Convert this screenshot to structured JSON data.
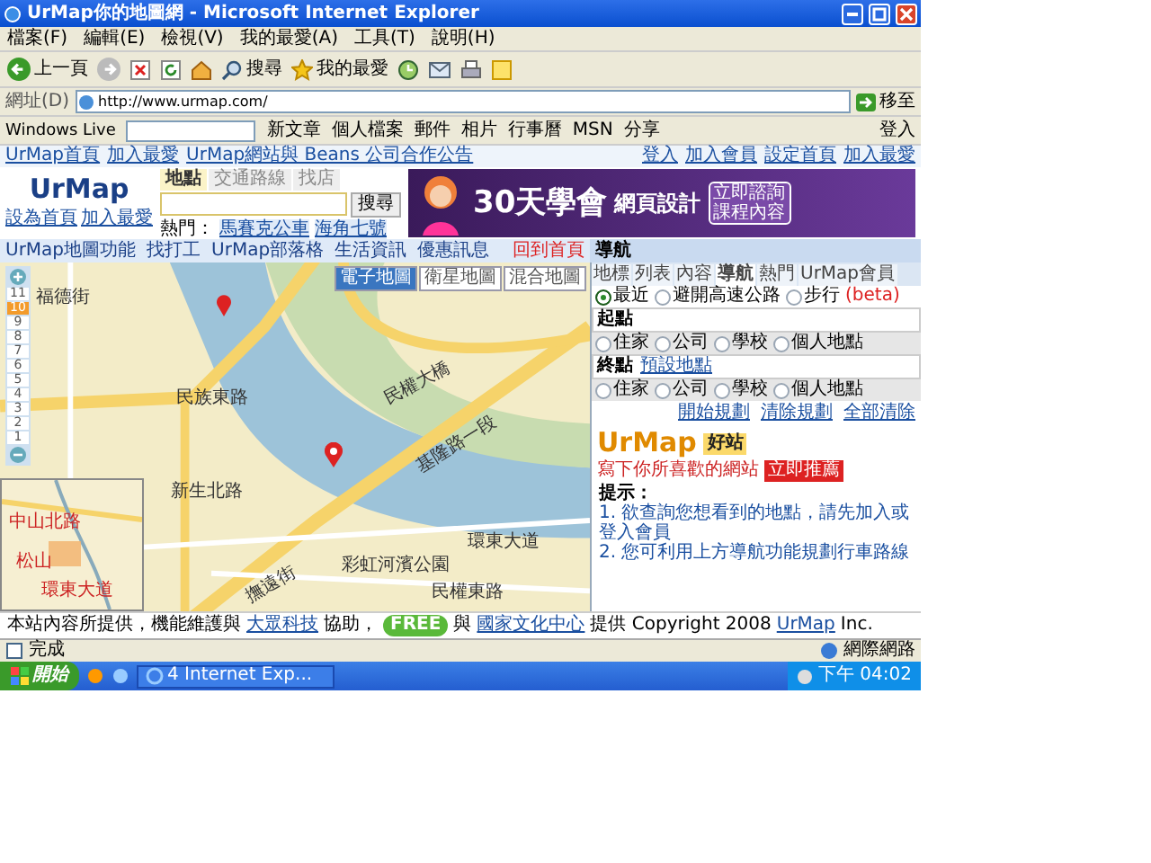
{
  "window": {
    "title": "UrMap你的地圖網 - Microsoft Internet Explorer"
  },
  "menu": [
    "檔案(F)",
    "編輯(E)",
    "檢視(V)",
    "我的最愛(A)",
    "工具(T)",
    "說明(H)"
  ],
  "toolbar": {
    "back": "上一頁",
    "search": "搜尋",
    "favorites": "我的最愛"
  },
  "address_bar": {
    "label": "網址(D)",
    "value": "http://www.urmap.com/",
    "go": "移至"
  },
  "live_bar": {
    "brand": "Windows Live",
    "items": [
      "新文章",
      "個人檔案",
      "郵件",
      "相片",
      "行事曆",
      "MSN",
      "分享"
    ],
    "signin": "登入"
  },
  "site_links": {
    "left": [
      "UrMap首頁",
      "加入最愛"
    ],
    "notice": "UrMap網站與 Beans 公司合作公告",
    "right": [
      "登入",
      "加入會員",
      "設定首頁",
      "加入最愛"
    ]
  },
  "site_header": {
    "logo": "UrMap",
    "logo_links": [
      "設為首頁",
      "加入最愛"
    ],
    "search_tabs": [
      {
        "label": "地點",
        "selected": true
      },
      {
        "label": "交通路線",
        "selected": false
      },
      {
        "label": "找店",
        "selected": false
      }
    ],
    "search_button": "搜尋",
    "hot_label": "熱門：",
    "hot_items": [
      "馬賽克公車",
      "海角七號"
    ],
    "banner": {
      "headline": "30天學會",
      "subline": "網頁設計",
      "cta": [
        "立即諮詢",
        "課程內容"
      ]
    }
  },
  "nav_bar": {
    "items": [
      "UrMap地圖功能",
      "找打工",
      "UrMap部落格",
      "生活資訊",
      "優惠訊息"
    ],
    "home_link": "回到首頁",
    "panel_title": "導航"
  },
  "map": {
    "type_tabs": [
      {
        "label": "電子地圖",
        "selected": true
      },
      {
        "label": "衛星地圖",
        "selected": false
      },
      {
        "label": "混合地圖",
        "selected": false
      }
    ],
    "zoom_levels": [
      {
        "label": "11",
        "selected": false
      },
      {
        "label": "10",
        "selected": true
      },
      {
        "label": "9",
        "selected": false
      },
      {
        "label": "8",
        "selected": false
      },
      {
        "label": "7",
        "selected": false
      },
      {
        "label": "6",
        "selected": false
      },
      {
        "label": "5",
        "selected": false
      },
      {
        "label": "4",
        "selected": false
      },
      {
        "label": "3",
        "selected": false
      },
      {
        "label": "2",
        "selected": false
      },
      {
        "label": "1",
        "selected": false
      }
    ],
    "street_labels": [
      "福德街",
      "民族東路",
      "民權大橋",
      "基隆路一段",
      "新生北路",
      "環東大道",
      "彩虹河濱公園",
      "撫遠街",
      "民權東路"
    ],
    "minimap_labels": [
      "中山北路",
      "松山",
      "環東大道"
    ]
  },
  "panel": {
    "tabs": [
      {
        "label": "地標",
        "selected": false
      },
      {
        "label": "列表",
        "selected": false
      },
      {
        "label": "內容",
        "selected": false
      },
      {
        "label": "導航",
        "selected": true
      },
      {
        "label": "熱門",
        "selected": false
      },
      {
        "label": "UrMap會員",
        "selected": false
      }
    ],
    "route_modes": [
      {
        "label": "最近",
        "selected": true
      },
      {
        "label": "避開高速公路",
        "selected": false
      },
      {
        "label": "步行",
        "selected": false
      }
    ],
    "beta": "(beta)",
    "start": {
      "label": "起點",
      "options": [
        {
          "label": "住家",
          "selected": false
        },
        {
          "label": "公司",
          "selected": false
        },
        {
          "label": "學校",
          "selected": false
        },
        {
          "label": "個人地點",
          "selected": false
        }
      ]
    },
    "end": {
      "label": "終點",
      "link": "預設地點",
      "options": [
        {
          "label": "住家",
          "selected": false
        },
        {
          "label": "公司",
          "selected": false
        },
        {
          "label": "學校",
          "selected": false
        },
        {
          "label": "個人地點",
          "selected": false
        }
      ]
    },
    "actions": [
      "開始規劃",
      "清除規劃",
      "全部清除"
    ],
    "promo": {
      "logo": "UrMap",
      "badge": "好站",
      "text": "寫下你所喜歡的網站",
      "button": "立即推薦"
    },
    "tips_title": "提示：",
    "tips": [
      "1. 欲查詢您想看到的地點，請先加入或登入會員",
      "2. 您可利用上方導航功能規劃行車路線"
    ]
  },
  "footer": [
    {
      "kind": "text",
      "text": "本站內容所提供，機能維護與"
    },
    {
      "kind": "link",
      "text": "大眾科技"
    },
    {
      "kind": "text",
      "text": "協助，"
    },
    {
      "kind": "badge",
      "text": "FREE"
    },
    {
      "kind": "text",
      "text": "與"
    },
    {
      "kind": "link",
      "text": "國家文化中心"
    },
    {
      "kind": "text",
      "text": "提供 Copyright 2008"
    },
    {
      "kind": "link",
      "text": "UrMap"
    },
    {
      "kind": "text",
      "text": "Inc."
    }
  ],
  "status_bar": {
    "text": "完成",
    "zone": "網際網路"
  },
  "taskbar": {
    "start": "開始",
    "task": "4 Internet Exp...",
    "clock": "下午 04:02"
  }
}
